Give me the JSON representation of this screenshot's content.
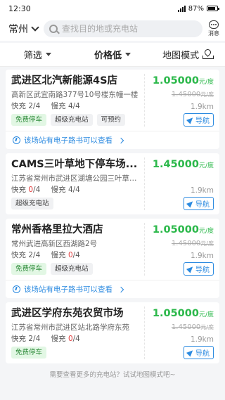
{
  "status_bar": {
    "time": "12:30",
    "battery": "87%",
    "battery_level": 0.87
  },
  "header": {
    "city": "常州",
    "search_placeholder": "查找目的地或充电站",
    "message_label": "消息"
  },
  "filters": [
    {
      "label": "筛选"
    },
    {
      "label": "价格低"
    },
    {
      "label": "地图模式"
    }
  ],
  "stations": [
    {
      "name": "武进区北汽新能源4S店",
      "address": "高新区武宜南路377号10号楼东幢一楼",
      "fast_label": "快充",
      "fast_available": "2",
      "fast_total": "/4",
      "slow_label": "慢充",
      "slow_available": "4",
      "slow_total": "/4",
      "tags": [
        "免费停车",
        "超级充电站",
        "可预约"
      ],
      "price": "1.05000",
      "price_unit": "元/度",
      "original_price": "1.45000",
      "original_unit": "元/度",
      "distance": "1.9km",
      "nav_label": "导航",
      "booking_text": "该场站有电子路书可以查看"
    },
    {
      "name": "CAMS三叶草地下停车场...",
      "address": "江苏省常州市武进区湖塘公园三叶草地...",
      "fast_label": "快充",
      "fast_available": "0",
      "fast_total": "/4",
      "slow_label": "慢充",
      "slow_available": "4",
      "slow_total": "/4",
      "tags": [
        "超级充电站"
      ],
      "price": "1.45000",
      "price_unit": "元/度",
      "original_price": "",
      "original_unit": "",
      "distance": "1.9km",
      "nav_label": "导航",
      "booking_text": ""
    },
    {
      "name": "常州香格里拉大酒店",
      "address": "常州武进高新区西湖路2号",
      "fast_label": "快充",
      "fast_available": "2",
      "fast_total": "/4",
      "slow_label": "慢充",
      "slow_available": "0",
      "slow_total": "/4",
      "tags": [
        "免费停车",
        "超级充电站"
      ],
      "price": "1.05000",
      "price_unit": "元/度",
      "original_price": "1.45000",
      "original_unit": "元/度",
      "distance": "1.9km",
      "nav_label": "导航",
      "booking_text": "该场站有电子路书可以查看"
    },
    {
      "name": "武进区学府东苑农贸市场",
      "address": "江苏省常州市武进区站北路学府东苑",
      "fast_label": "快充",
      "fast_available": "2",
      "fast_total": "/4",
      "slow_label": "慢充",
      "slow_available": "0",
      "slow_total": "/4",
      "tags": [
        "免费停车"
      ],
      "price": "1.05000",
      "price_unit": "元/度",
      "original_price": "1.45000",
      "original_unit": "元/度",
      "distance": "1.9km",
      "nav_label": "导航",
      "booking_text": ""
    }
  ],
  "footer_hint": "需要查看更多的充电站？试试地图模式吧~",
  "colors": {
    "price_green": "#2bb84a",
    "link_blue": "#2b8ae0",
    "alert_red": "#e03a3a"
  }
}
